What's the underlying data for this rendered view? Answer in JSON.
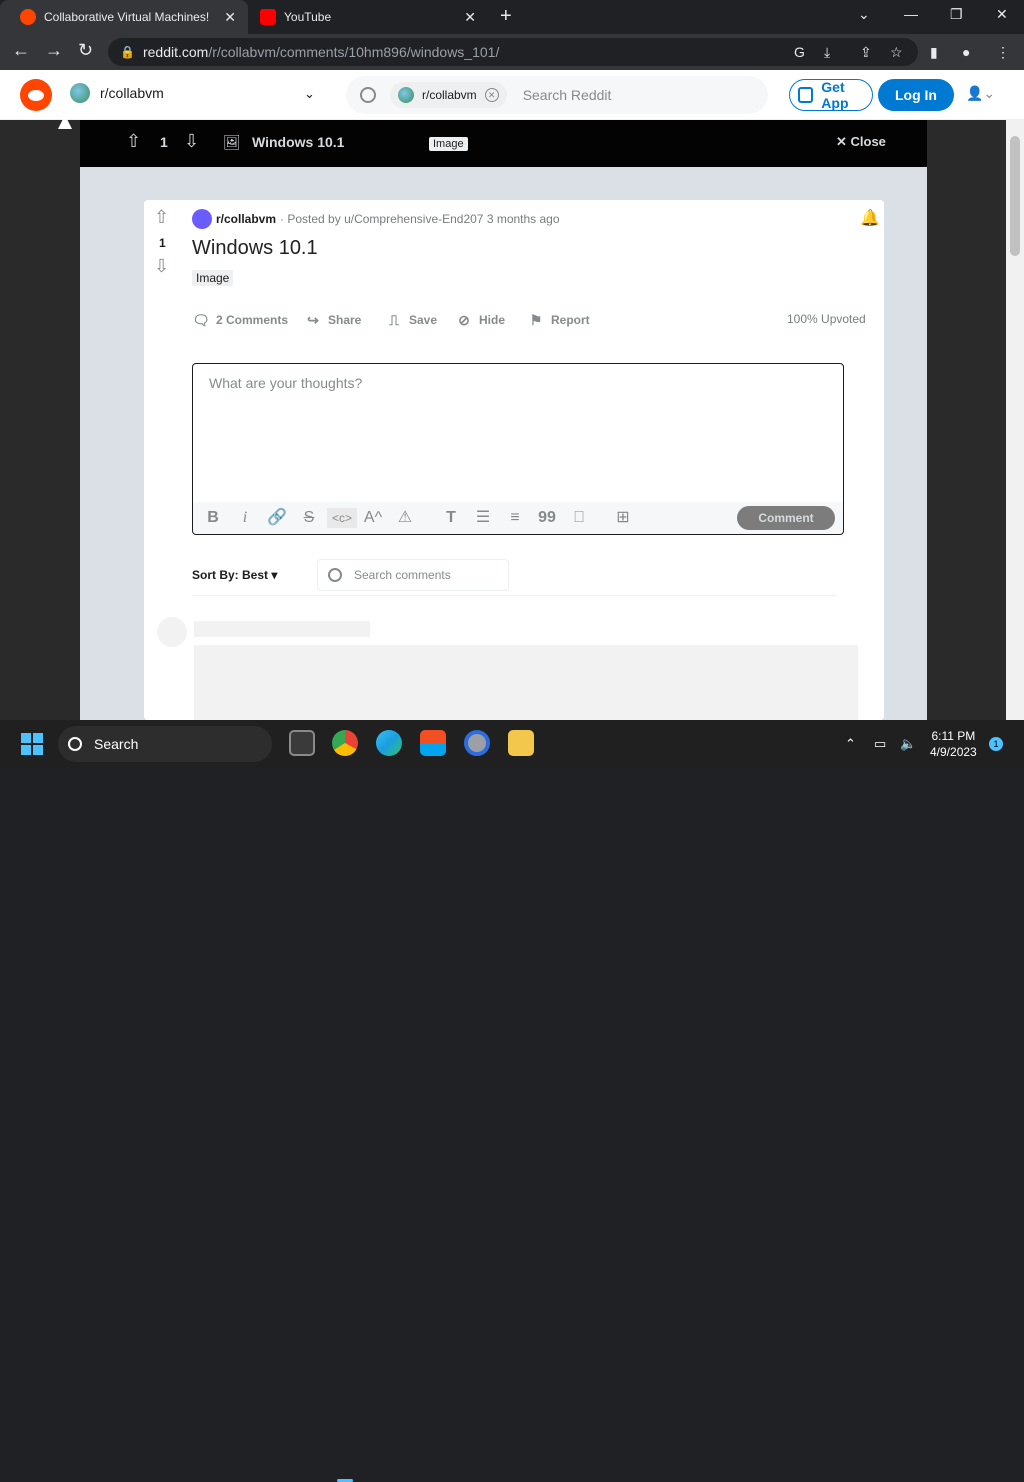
{
  "browser": {
    "tabs": [
      {
        "title": "Collaborative Virtual Machines!",
        "icon": "reddit-favicon"
      },
      {
        "title": "YouTube",
        "icon": "youtube-favicon"
      }
    ],
    "address": {
      "host": "reddit.com",
      "path": "/r/collabvm/comments/10hm896/windows_101/"
    }
  },
  "reddit_header": {
    "subreddit": "r/collabvm",
    "search_chip": "r/collabvm",
    "search_placeholder": "Search Reddit",
    "get_app": "Get App",
    "log_in": "Log In"
  },
  "post_bar": {
    "votes": "1",
    "title": "Windows 10.1",
    "flair": "Image",
    "close": "Close"
  },
  "post": {
    "subreddit": "r/collabvm",
    "meta": "· Posted by u/Comprehensive-End207 3 months ago",
    "votes": "1",
    "title": "Windows 10.1",
    "flair": "Image",
    "actions": {
      "comments": "2 Comments",
      "share": "Share",
      "save": "Save",
      "hide": "Hide",
      "report": "Report"
    },
    "upvoted": "100% Upvoted"
  },
  "comment_box": {
    "placeholder": "What are your thoughts?",
    "submit": "Comment"
  },
  "comments": {
    "sort_label": "Sort By: Best",
    "search_placeholder": "Search comments"
  },
  "taskbar": {
    "search": "Search",
    "time": "6:11 PM",
    "date": "4/9/2023",
    "notifications": "1"
  },
  "colors": {
    "reddit_orange": "#ff4500",
    "reddit_blue": "#0079d3",
    "taskbar_accent": "#4cc2ff"
  }
}
